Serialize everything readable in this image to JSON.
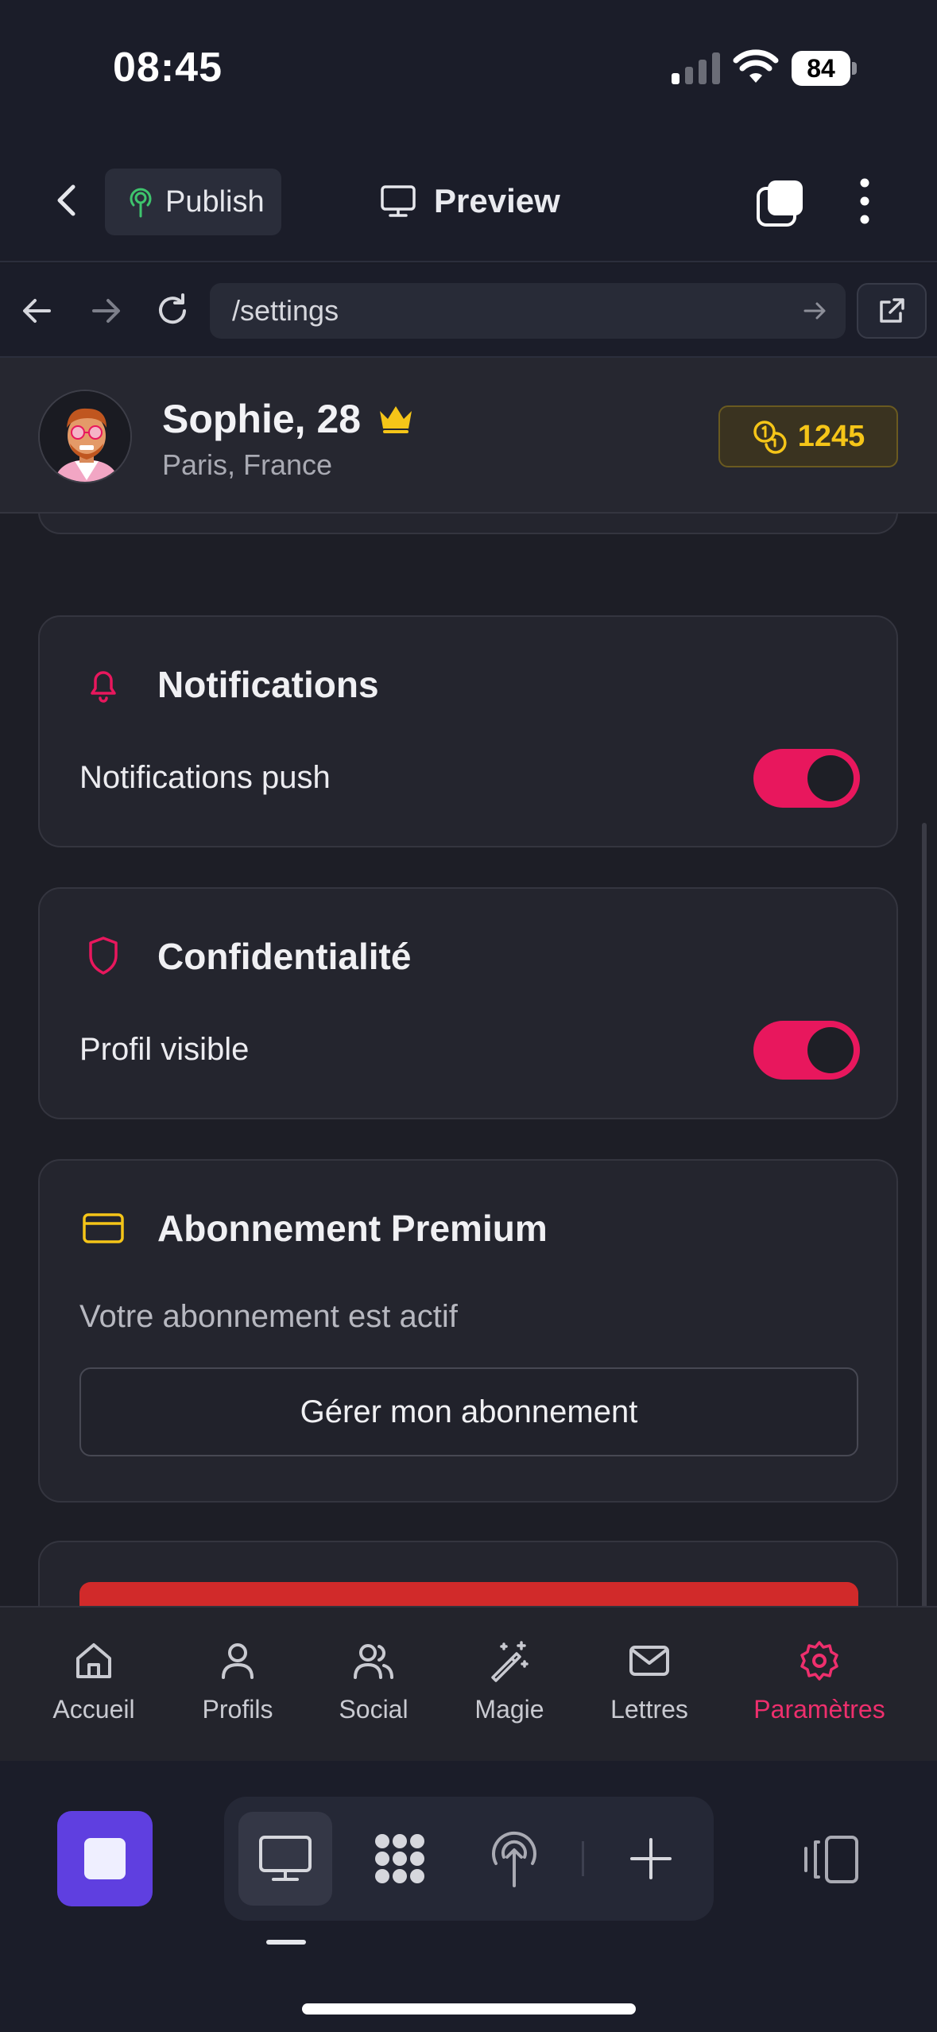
{
  "status_bar": {
    "time": "08:45",
    "battery": "84"
  },
  "editor_bar": {
    "publish_label": "Publish",
    "preview_label": "Preview"
  },
  "browser": {
    "url": "/settings"
  },
  "profile": {
    "name": "Sophie, 28",
    "location": "Paris, France",
    "coins": "1245"
  },
  "sections": {
    "notifications": {
      "title": "Notifications",
      "row_label": "Notifications push",
      "enabled": true
    },
    "privacy": {
      "title": "Confidentialité",
      "row_label": "Profil visible",
      "enabled": true
    },
    "premium": {
      "title": "Abonnement Premium",
      "status_text": "Votre abonnement est actif",
      "button_label": "Gérer mon abonnement"
    }
  },
  "bottom_nav": {
    "items": [
      {
        "label": "Accueil",
        "icon": "home-icon"
      },
      {
        "label": "Profils",
        "icon": "user-icon"
      },
      {
        "label": "Social",
        "icon": "users-icon"
      },
      {
        "label": "Magie",
        "icon": "magic-wand-icon"
      },
      {
        "label": "Lettres",
        "icon": "mail-icon"
      },
      {
        "label": "Paramètres",
        "icon": "gear-icon",
        "active": true
      }
    ]
  },
  "colors": {
    "accent": "#e8175d",
    "gold": "#f5c518",
    "danger": "#d12a2a",
    "stop": "#5f3fe0"
  }
}
